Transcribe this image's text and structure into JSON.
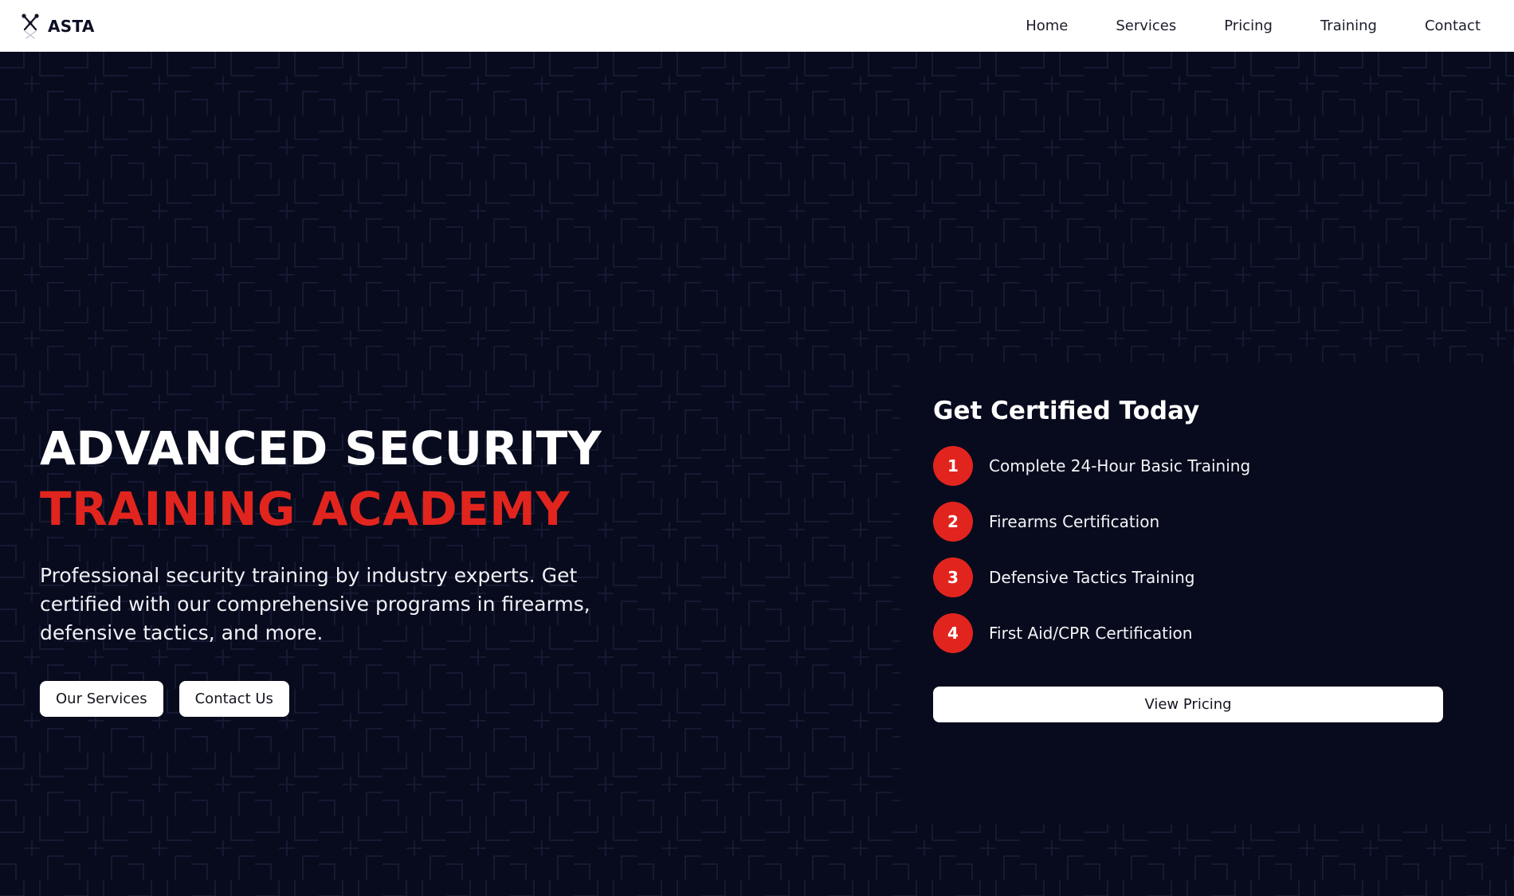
{
  "brand": {
    "name": "ASTA",
    "logo_icon": "crossed-weapons-icon"
  },
  "nav": {
    "items": [
      {
        "label": "Home"
      },
      {
        "label": "Services"
      },
      {
        "label": "Pricing"
      },
      {
        "label": "Training"
      },
      {
        "label": "Contact"
      }
    ]
  },
  "hero": {
    "title_line1": "ADVANCED SECURITY",
    "title_line2": "TRAINING ACADEMY",
    "description": "Professional security training by industry experts. Get certified with our comprehensive programs in firearms, defensive tactics, and more.",
    "buttons": {
      "services": "Our Services",
      "contact": "Contact Us"
    }
  },
  "certification": {
    "title": "Get Certified Today",
    "steps": [
      {
        "number": "1",
        "label": "Complete 24-Hour Basic Training"
      },
      {
        "number": "2",
        "label": "Firearms Certification"
      },
      {
        "number": "3",
        "label": "Defensive Tactics Training"
      },
      {
        "number": "4",
        "label": "First Aid/CPR Certification"
      }
    ],
    "cta": "View Pricing"
  },
  "colors": {
    "background": "#080b1d",
    "accent": "#e1251e",
    "header_bg": "#ffffff",
    "text_light": "#ffffff",
    "pattern_line": "#141a33"
  }
}
